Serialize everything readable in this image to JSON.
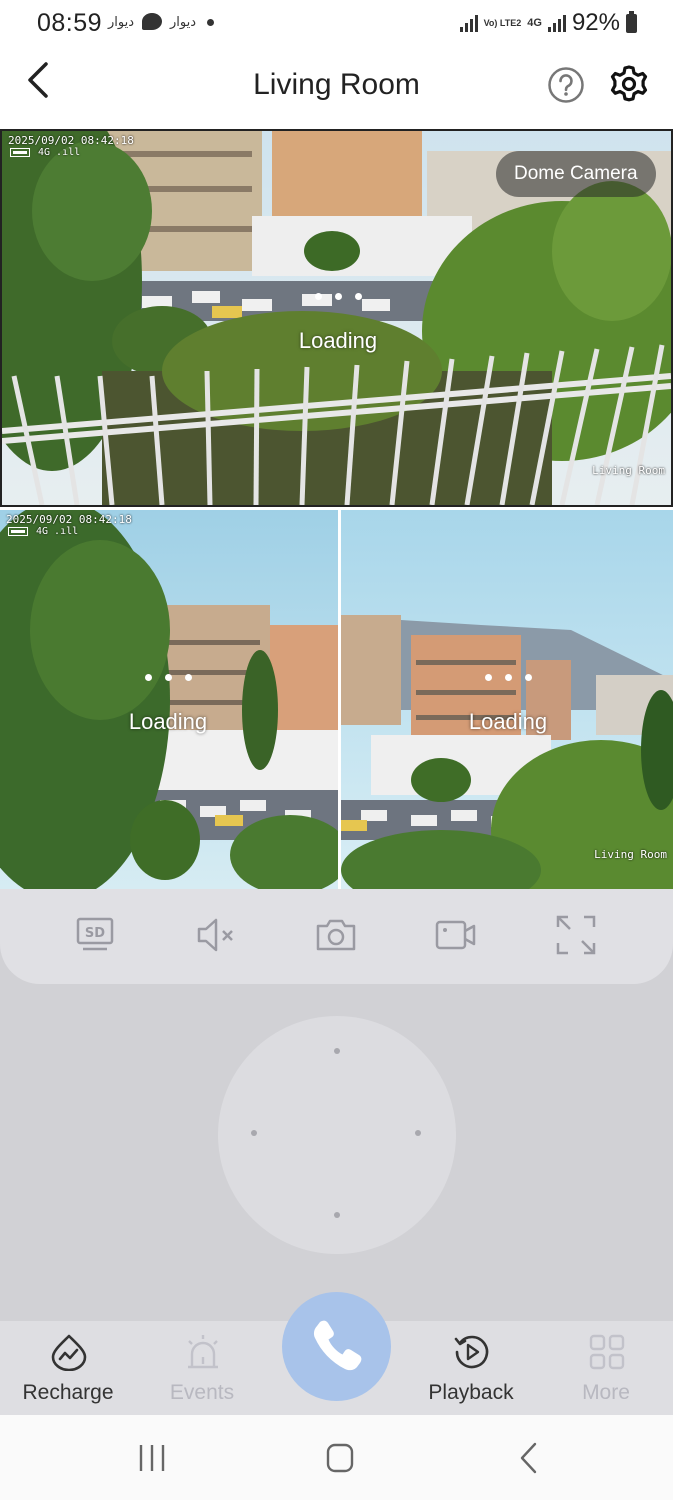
{
  "status_bar": {
    "time": "08:59",
    "notif_1": "دیوار",
    "notif_2": "دیوار",
    "volte": "Vo) LTE2",
    "network": "4G",
    "battery": "92%"
  },
  "header": {
    "title": "Living Room",
    "back_icon": "chevron-left-icon",
    "help_icon": "help-circle-icon",
    "settings_icon": "gear-icon"
  },
  "cameras": {
    "main": {
      "timestamp": "2025/09/02 08:42:18",
      "net": "4G .ıll",
      "tag": "Dome Camera",
      "loading": "Loading",
      "watermark": "Living Room"
    },
    "left": {
      "timestamp": "2025/09/02 08:42:18",
      "net": "4G .ıll",
      "loading": "Loading"
    },
    "right": {
      "loading": "Loading",
      "watermark": "Living Room"
    }
  },
  "toolbar": {
    "items": [
      "sd-quality-icon",
      "mute-icon",
      "snapshot-camera-icon",
      "record-video-icon",
      "fullscreen-icon"
    ]
  },
  "bottom_nav": {
    "recharge": "Recharge",
    "events": "Events",
    "playback": "Playback",
    "more": "More",
    "call_icon": "phone-icon"
  },
  "colors": {
    "accent_call": "#a8c3ea",
    "disabled_text": "#b8b8c0",
    "panel_bg": "#d1d1d5"
  }
}
